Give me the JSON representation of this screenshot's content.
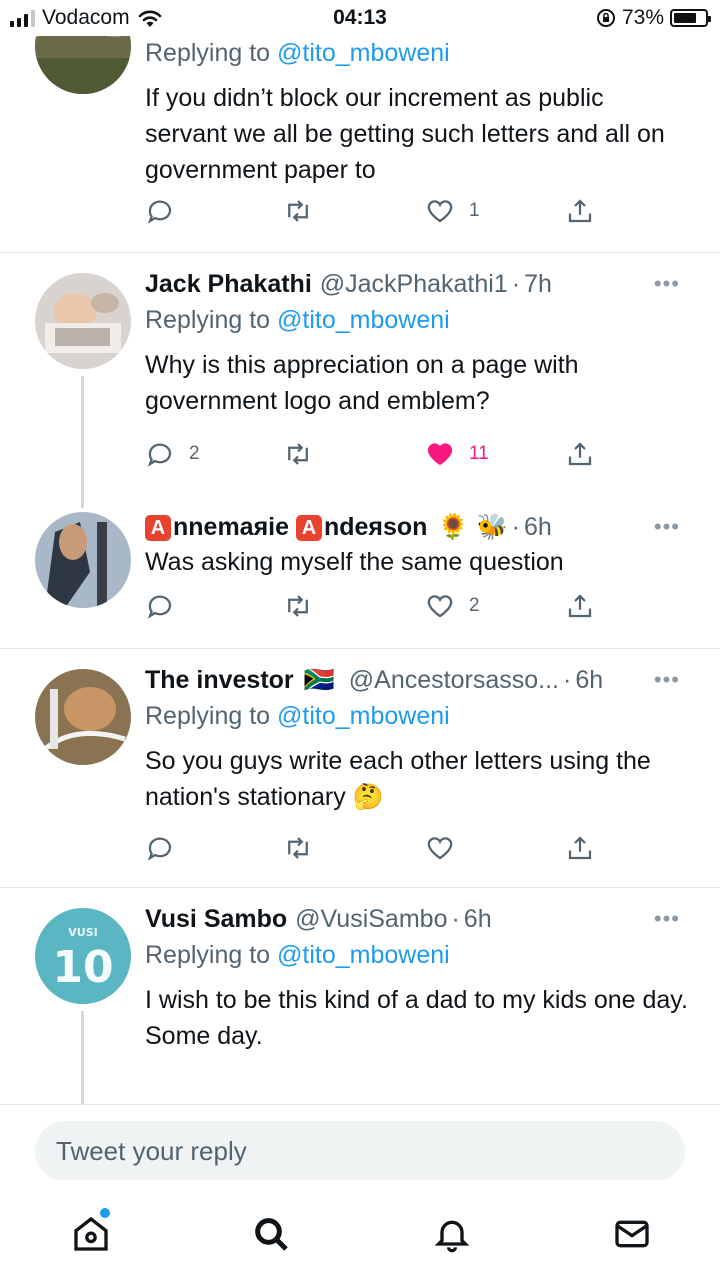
{
  "status_bar": {
    "carrier": "Vodacom",
    "time": "04:13",
    "battery": "73%",
    "battery_level": 0.73
  },
  "tweets": [
    {
      "name": "",
      "handle": "",
      "time": "",
      "replying_prefix": "Replying to ",
      "replying_to": "@tito_mboweni",
      "text": "If you didn’t block our increment as public servant we all be getting such letters and all on government paper to",
      "reply_count": "",
      "retweet_count": "",
      "like_count": "1",
      "liked": false
    },
    {
      "name": "Jack Phakathi",
      "handle": "@JackPhakathi1",
      "time": "7h",
      "replying_prefix": "Replying to ",
      "replying_to": "@tito_mboweni",
      "text": "Why is this appreciation on a page with government logo and emblem?",
      "reply_count": "2",
      "retweet_count": "",
      "like_count": "11",
      "liked": true
    },
    {
      "name_a": "A",
      "name_mid": "nnemaяie ",
      "name_b": "A",
      "name_end": "ndeяson",
      "name_emoji": "🌻 🐝",
      "time": "6h",
      "text": "Was asking myself the same question",
      "reply_count": "",
      "retweet_count": "",
      "like_count": "2",
      "liked": false
    },
    {
      "name": "The investor",
      "flag": "🇿🇦",
      "handle": "@Ancestorsasso...",
      "time": "6h",
      "replying_prefix": "Replying to ",
      "replying_to": "@tito_mboweni",
      "text": "So you guys write each other letters using the nation's stationary 🤔",
      "reply_count": "",
      "retweet_count": "",
      "like_count": "",
      "liked": false
    },
    {
      "name": "Vusi Sambo",
      "handle": "@VusiSambo",
      "time": "6h",
      "replying_prefix": "Replying to ",
      "replying_to": "@tito_mboweni",
      "text": "I wish to be this kind of a dad to my kids one day. Some day.",
      "avatar_text_top": "VUSI",
      "avatar_text_num": "10"
    }
  ],
  "more_label": "•••",
  "reply_placeholder": "Tweet your reply",
  "nav": [
    "home-icon",
    "search-icon",
    "notifications-icon",
    "messages-icon"
  ],
  "colors": {
    "accent": "#1d9bf0",
    "like": "#f91880",
    "muted": "#536471"
  }
}
